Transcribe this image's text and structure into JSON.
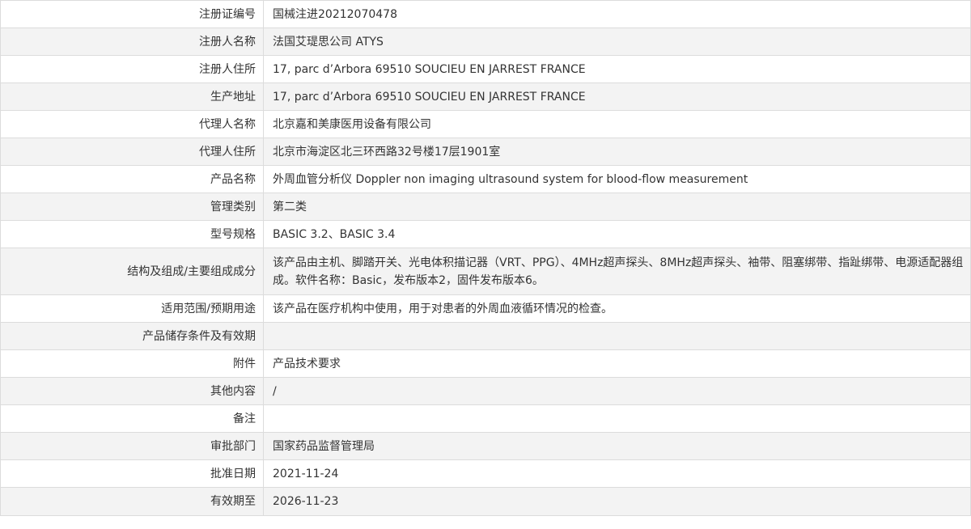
{
  "rows": [
    {
      "label": "注册证编号",
      "value": "国械注进20212070478"
    },
    {
      "label": "注册人名称",
      "value": "法国艾瑅思公司 ATYS"
    },
    {
      "label": "注册人住所",
      "value": "17, parc d’Arbora 69510 SOUCIEU EN JARREST FRANCE"
    },
    {
      "label": "生产地址",
      "value": "17, parc d’Arbora 69510 SOUCIEU EN JARREST FRANCE"
    },
    {
      "label": "代理人名称",
      "value": "北京嘉和美康医用设备有限公司"
    },
    {
      "label": "代理人住所",
      "value": "北京市海淀区北三环西路32号楼17层1901室"
    },
    {
      "label": "产品名称",
      "value": "外周血管分析仪 Doppler non imaging ultrasound system for blood-flow measurement"
    },
    {
      "label": "管理类别",
      "value": "第二类"
    },
    {
      "label": "型号规格",
      "value": "BASIC 3.2、BASIC 3.4"
    },
    {
      "label": "结构及组成/主要组成成分",
      "value": "该产品由主机、脚踏开关、光电体积描记器（VRT、PPG）、4MHz超声探头、8MHz超声探头、袖带、阻塞绑带、指趾绑带、电源适配器组成。软件名称：Basic，发布版本2，固件发布版本6。"
    },
    {
      "label": "适用范围/预期用途",
      "value": "该产品在医疗机构中使用，用于对患者的外周血液循环情况的检查。"
    },
    {
      "label": "产品储存条件及有效期",
      "value": ""
    },
    {
      "label": "附件",
      "value": "产品技术要求"
    },
    {
      "label": "其他内容",
      "value": "/"
    },
    {
      "label": "备注",
      "value": ""
    },
    {
      "label": "审批部门",
      "value": "国家药品监督管理局"
    },
    {
      "label": "批准日期",
      "value": "2021-11-24"
    },
    {
      "label": "有效期至",
      "value": "2026-11-23"
    }
  ]
}
